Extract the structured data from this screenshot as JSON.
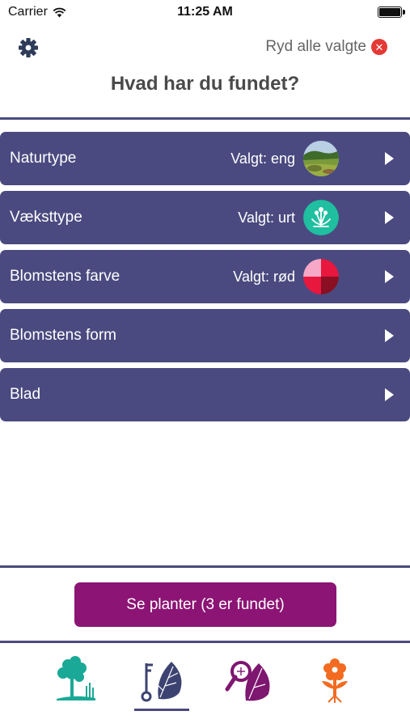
{
  "status_bar": {
    "carrier": "Carrier",
    "time": "11:25 AM"
  },
  "header": {
    "clear_label": "Ryd alle valgte",
    "title": "Hvad har du fundet?"
  },
  "filters": [
    {
      "label": "Naturtype",
      "selected": "Valgt: eng",
      "thumb": "meadow-photo"
    },
    {
      "label": "Vækst­type",
      "selected": "Valgt: urt",
      "thumb": "herb-icon"
    },
    {
      "label": "Blomstens farve",
      "selected": "Valgt: rød",
      "thumb": "red-color-swatch"
    },
    {
      "label": "Blomstens form",
      "selected": "",
      "thumb": ""
    },
    {
      "label": "Blad",
      "selected": "",
      "thumb": ""
    }
  ],
  "cta": {
    "label": "Se planter (3 er fundet)"
  },
  "tabs": [
    {
      "icon": "tree-habitat-icon",
      "active": false
    },
    {
      "icon": "key-leaf-icon",
      "active": true
    },
    {
      "icon": "magnifier-leaf-icon",
      "active": false
    },
    {
      "icon": "flower-icon",
      "active": false
    }
  ],
  "colors": {
    "accent": "#4a4a80",
    "cta": "#8c1474",
    "clear_icon": "#e53935",
    "teal_icon": "#1fbfa0"
  }
}
